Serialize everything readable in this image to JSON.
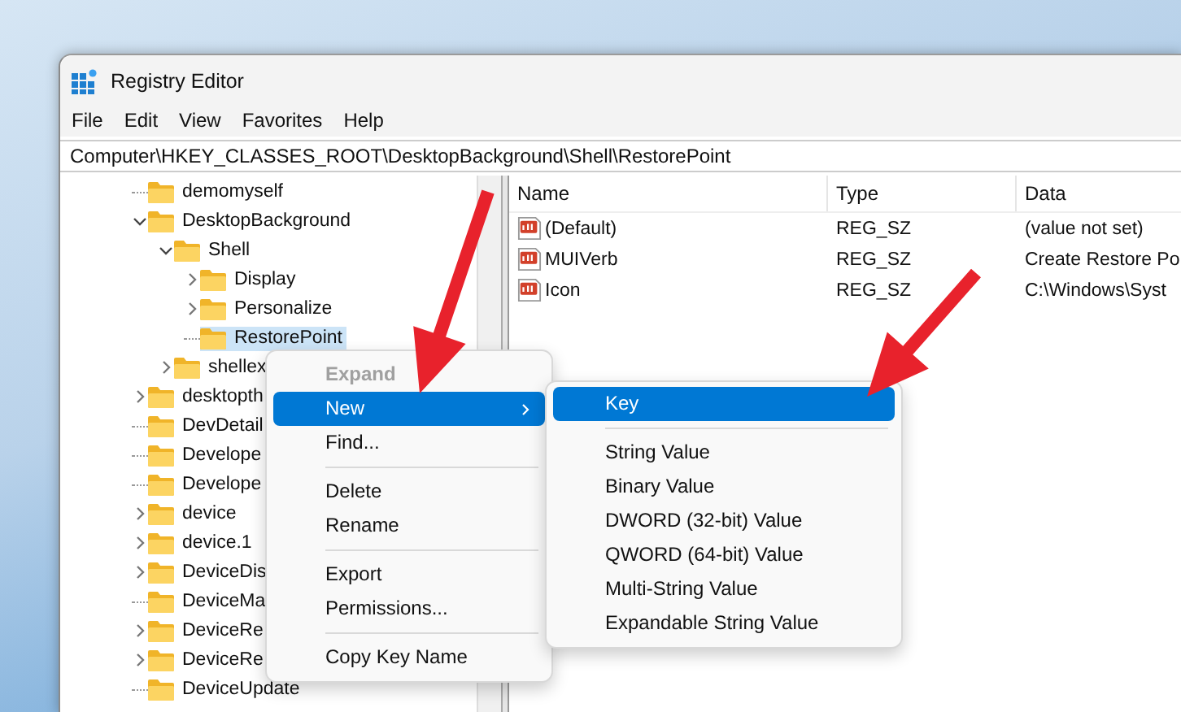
{
  "window": {
    "title": "Registry Editor"
  },
  "menu_bar": [
    "File",
    "Edit",
    "View",
    "Favorites",
    "Help"
  ],
  "address": "Computer\\HKEY_CLASSES_ROOT\\DesktopBackground\\Shell\\RestorePoint",
  "tree": [
    {
      "label": "demomyself",
      "expandable": false,
      "selected": false
    },
    {
      "label": "DesktopBackground",
      "expandable": true,
      "expanded": true,
      "selected": false,
      "children": [
        {
          "label": "Shell",
          "expandable": true,
          "expanded": true,
          "selected": false,
          "children": [
            {
              "label": "Display",
              "expandable": true,
              "expanded": false,
              "selected": false
            },
            {
              "label": "Personalize",
              "expandable": true,
              "expanded": false,
              "selected": false
            },
            {
              "label": "RestorePoint",
              "expandable": false,
              "selected": true
            }
          ]
        },
        {
          "label": "shellex",
          "expandable": true,
          "expanded": false,
          "selected": false
        }
      ]
    },
    {
      "label": "desktopth",
      "expandable": true,
      "expanded": false,
      "selected": false
    },
    {
      "label": "DevDetail",
      "expandable": false,
      "selected": false
    },
    {
      "label": "Develope",
      "expandable": false,
      "selected": false
    },
    {
      "label": "Develope",
      "expandable": false,
      "selected": false
    },
    {
      "label": "device",
      "expandable": true,
      "expanded": false,
      "selected": false
    },
    {
      "label": "device.1",
      "expandable": true,
      "expanded": false,
      "selected": false
    },
    {
      "label": "DeviceDis",
      "expandable": true,
      "expanded": false,
      "selected": false
    },
    {
      "label": "DeviceMa",
      "expandable": false,
      "selected": false
    },
    {
      "label": "DeviceRe",
      "expandable": true,
      "expanded": false,
      "selected": false
    },
    {
      "label": "DeviceRe",
      "expandable": true,
      "expanded": false,
      "selected": false
    },
    {
      "label": "DeviceUpdate",
      "expandable": false,
      "selected": false
    }
  ],
  "values": {
    "columns": [
      "Name",
      "Type",
      "Data"
    ],
    "rows": [
      {
        "name": "(Default)",
        "type": "REG_SZ",
        "data": "(value not set)"
      },
      {
        "name": "MUIVerb",
        "type": "REG_SZ",
        "data": "Create Restore Po"
      },
      {
        "name": "Icon",
        "type": "REG_SZ",
        "data": "C:\\Windows\\Syst"
      }
    ]
  },
  "context_menu": {
    "sections": [
      {
        "items": [
          {
            "label": "Expand",
            "disabled": true,
            "selected": false,
            "submenu": false
          },
          {
            "label": "New",
            "disabled": false,
            "selected": true,
            "submenu": true
          },
          {
            "label": "Find...",
            "disabled": false,
            "selected": false,
            "submenu": false
          }
        ]
      },
      {
        "items": [
          {
            "label": "Delete",
            "disabled": false,
            "selected": false,
            "submenu": false
          },
          {
            "label": "Rename",
            "disabled": false,
            "selected": false,
            "submenu": false
          }
        ]
      },
      {
        "items": [
          {
            "label": "Export",
            "disabled": false,
            "selected": false,
            "submenu": false
          },
          {
            "label": "Permissions...",
            "disabled": false,
            "selected": false,
            "submenu": false
          }
        ]
      },
      {
        "items": [
          {
            "label": "Copy Key Name",
            "disabled": false,
            "selected": false,
            "submenu": false
          }
        ]
      }
    ]
  },
  "submenu": {
    "sections": [
      {
        "items": [
          {
            "label": "Key",
            "selected": true
          }
        ]
      },
      {
        "items": [
          {
            "label": "String Value",
            "selected": false
          },
          {
            "label": "Binary Value",
            "selected": false
          },
          {
            "label": "DWORD (32-bit) Value",
            "selected": false
          },
          {
            "label": "QWORD (64-bit) Value",
            "selected": false
          },
          {
            "label": "Multi-String Value",
            "selected": false
          },
          {
            "label": "Expandable String Value",
            "selected": false
          }
        ]
      }
    ]
  }
}
